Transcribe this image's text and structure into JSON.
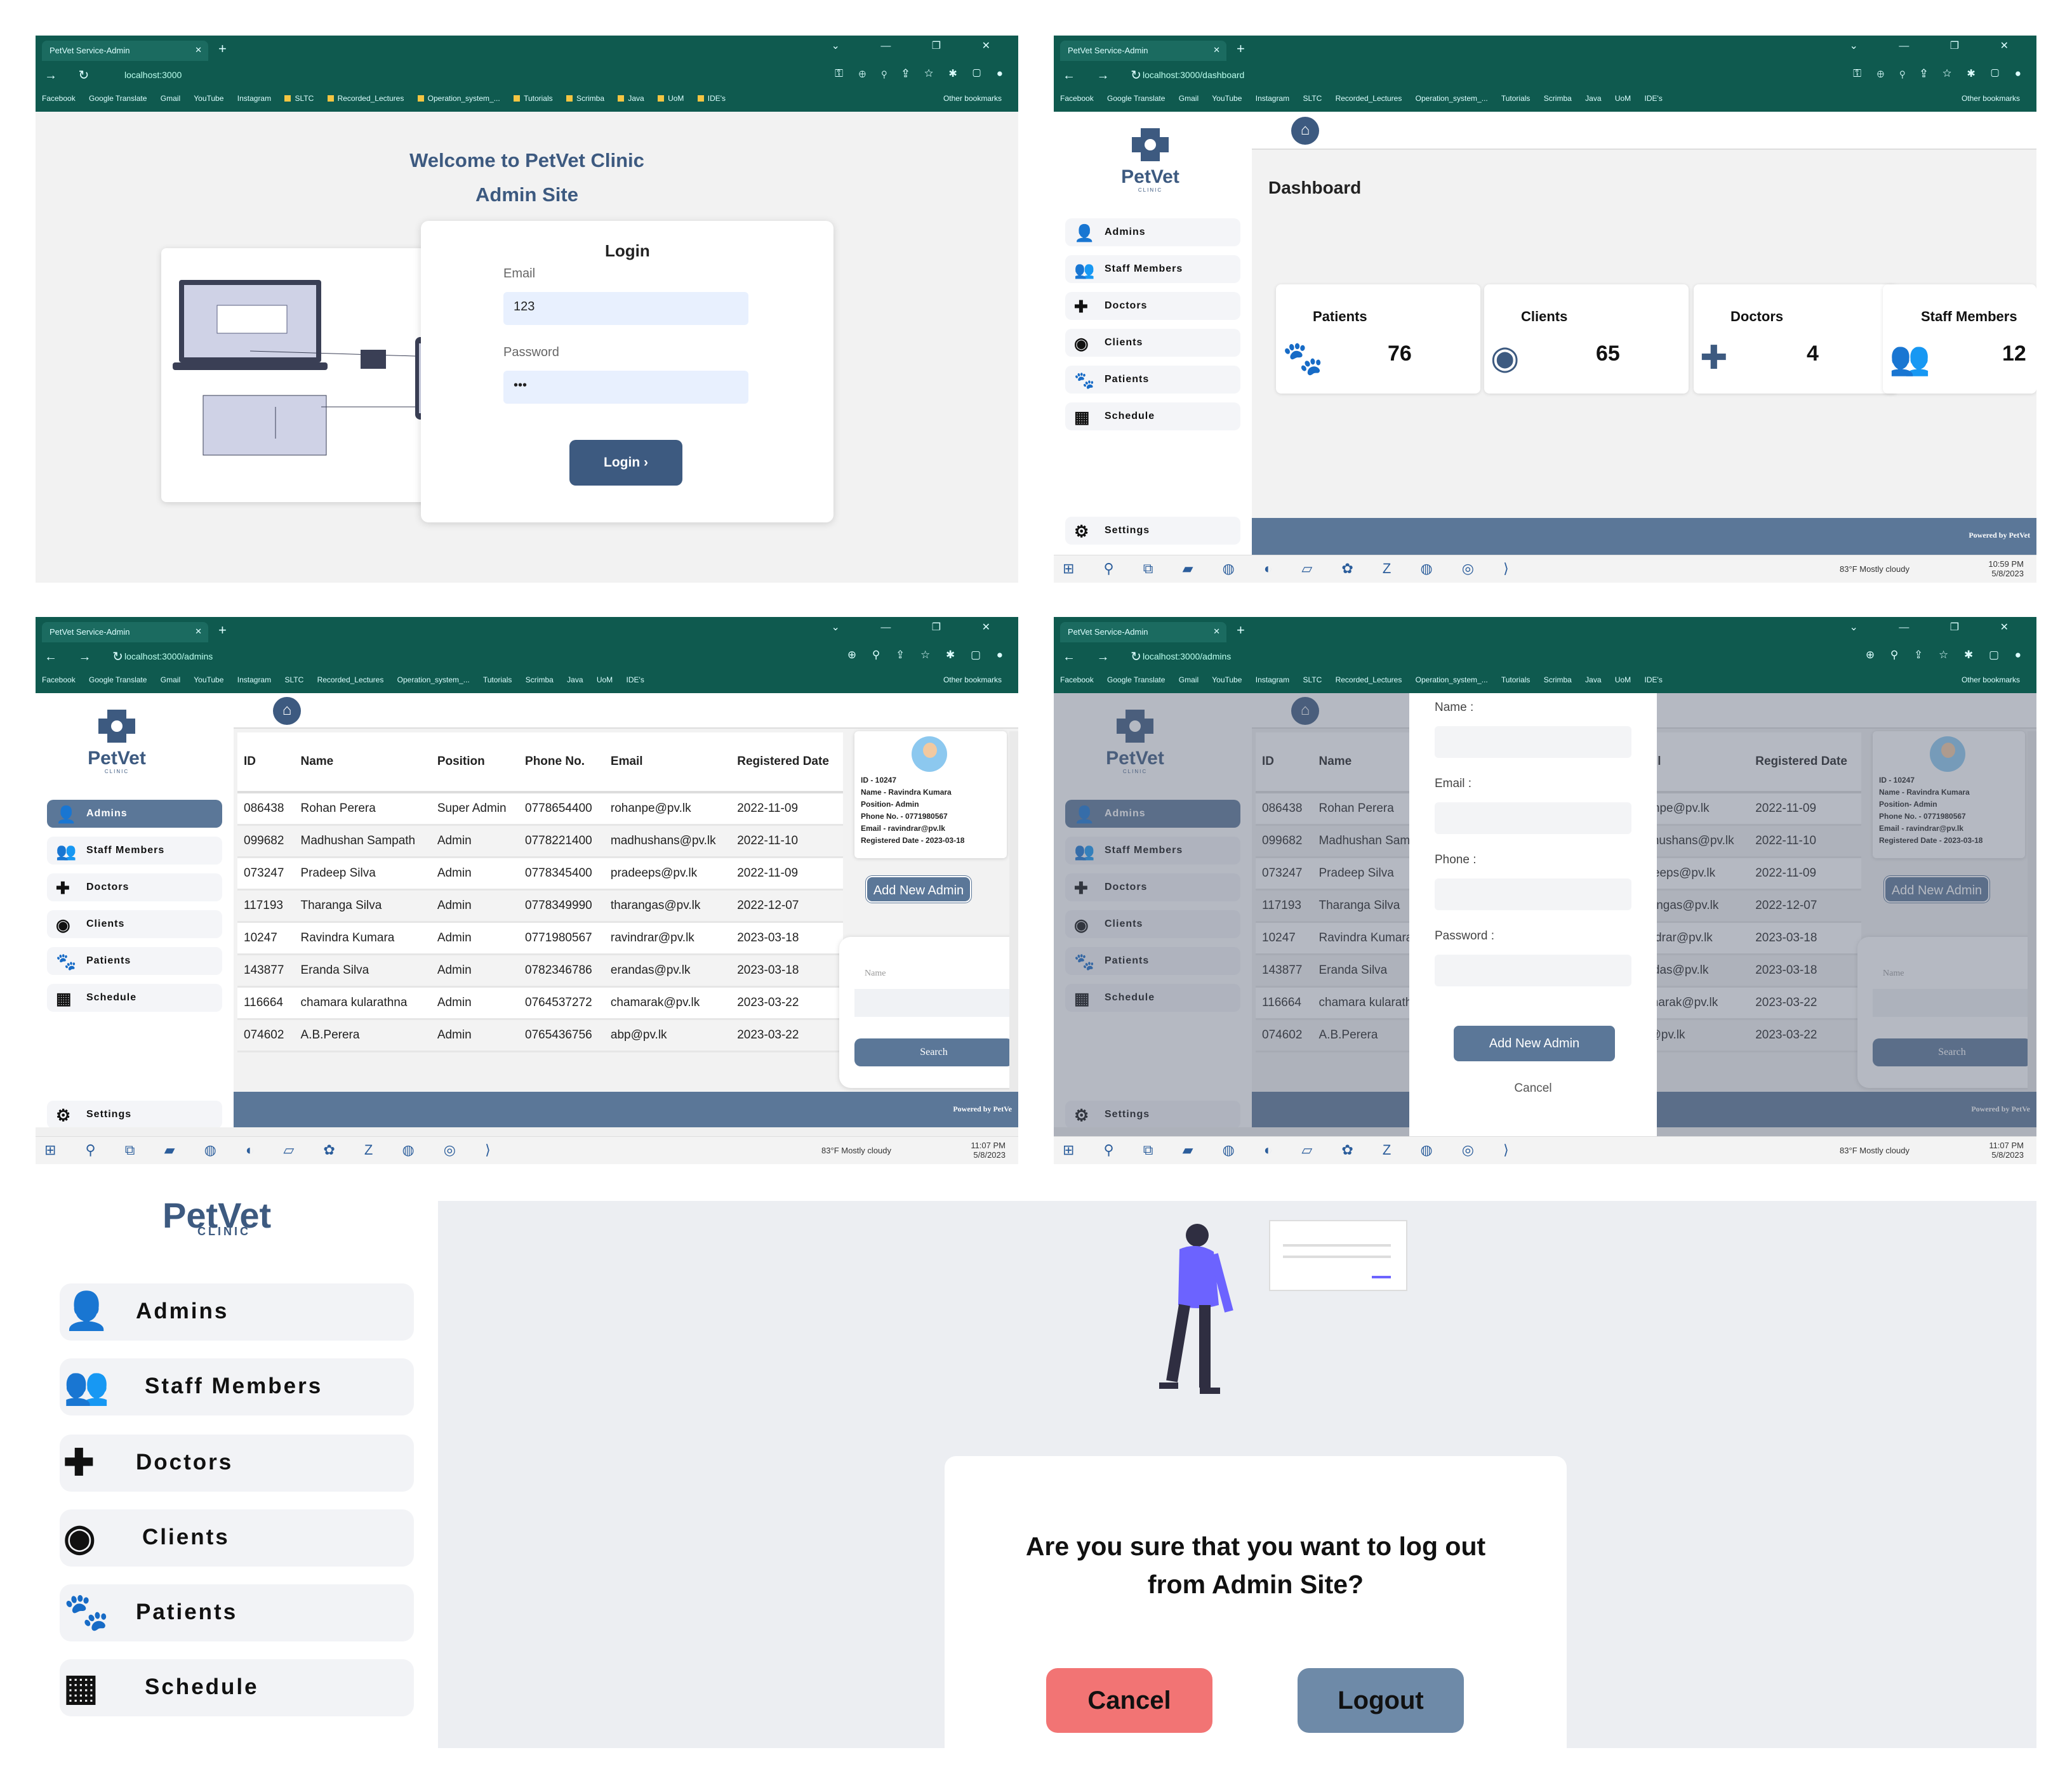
{
  "browser": {
    "tab_title": "PetVet Service-Admin",
    "new_tab": "+",
    "win_controls": "⌄ — ❐ ✕",
    "bookmarks": [
      "Facebook",
      "Google Translate",
      "Gmail",
      "YouTube",
      "Instagram",
      "SLTC",
      "Recorded_Lectures",
      "Operation_system_...",
      "Tutorials",
      "Scrimba",
      "Java",
      "UoM",
      "IDE's"
    ],
    "bookmarks_more": "»",
    "other_bookmarks": "Other bookmarks"
  },
  "taskbar": {
    "weather": "83°F  Mostly cloudy",
    "time_dashboard": "10:59 PM",
    "time_admins": "11:07 PM",
    "date": "5/8/2023"
  },
  "login_page": {
    "url": "localhost:3000",
    "welcome_line1": "Welcome to PetVet Clinic",
    "welcome_line2": "Admin Site",
    "heading": "Login",
    "email_label": "Email",
    "email_value": "123",
    "password_label": "Password",
    "password_value": "•••",
    "login_button": "Login ›"
  },
  "sidebar": {
    "logo_text": "PetVet",
    "logo_sub": "CLINIC",
    "items": [
      {
        "label": "Admins",
        "icon": "user-icon"
      },
      {
        "label": "Staff Members",
        "icon": "users-icon"
      },
      {
        "label": "Doctors",
        "icon": "medkit-icon"
      },
      {
        "label": "Clients",
        "icon": "user-circle-icon"
      },
      {
        "label": "Patients",
        "icon": "paw-icon"
      },
      {
        "label": "Schedule",
        "icon": "calendar-icon"
      }
    ],
    "settings": "Settings"
  },
  "dashboard": {
    "url": "localhost:3000/dashboard",
    "title": "Dashboard",
    "stats": [
      {
        "label": "Patients",
        "value": "76",
        "icon": "paw-icon"
      },
      {
        "label": "Clients",
        "value": "65",
        "icon": "user-circle-icon"
      },
      {
        "label": "Doctors",
        "value": "4",
        "icon": "medkit-icon"
      },
      {
        "label": "Staff Members",
        "value": "12",
        "icon": "users-icon"
      }
    ],
    "footer": "Powered by PetVet"
  },
  "admins_page": {
    "url": "localhost:3000/admins",
    "columns": [
      "ID",
      "Name",
      "Position",
      "Phone No.",
      "Email",
      "Registered Date"
    ],
    "rows": [
      [
        "086438",
        "Rohan Perera",
        "Super Admin",
        "0778654400",
        "rohanpe@pv.lk",
        "2022-11-09"
      ],
      [
        "099682",
        "Madhushan Sampath",
        "Admin",
        "0778221400",
        "madhushans@pv.lk",
        "2022-11-10"
      ],
      [
        "073247",
        "Pradeep Silva",
        "Admin",
        "0778345400",
        "pradeeps@pv.lk",
        "2022-11-09"
      ],
      [
        "117193",
        "Tharanga Silva",
        "Admin",
        "0778349990",
        "tharangas@pv.lk",
        "2022-12-07"
      ],
      [
        "10247",
        "Ravindra Kumara",
        "Admin",
        "0771980567",
        "ravindrar@pv.lk",
        "2023-03-18"
      ],
      [
        "143877",
        "Eranda Silva",
        "Admin",
        "0782346786",
        "erandas@pv.lk",
        "2023-03-18"
      ],
      [
        "116664",
        "chamara kularathna",
        "Admin",
        "0764537272",
        "chamarak@pv.lk",
        "2023-03-22"
      ],
      [
        "074602",
        "A.B.Perera",
        "Admin",
        "0765436756",
        "abp@pv.lk",
        "2023-03-22"
      ]
    ],
    "profile": {
      "id": "ID - 10247",
      "name": "Name - Ravindra Kumara",
      "position": "Position- Admin",
      "phone": "Phone No. - 0771980567",
      "email": "Email - ravindrar@pv.lk",
      "registered": "Registered Date - 2023-03-18"
    },
    "add_button": "Add New Admin",
    "search_label": "Name",
    "search_button": "Search",
    "footer": "Powered by PetVe"
  },
  "add_admin_modal": {
    "name_label": "Name :",
    "email_label": "Email :",
    "phone_label": "Phone :",
    "password_label": "Password :",
    "submit": "Add New Admin",
    "cancel": "Cancel"
  },
  "logout_page": {
    "logo_text": "PetVet",
    "logo_sub": "CLINIC",
    "question_line1": "Are you sure that you want to log out",
    "question_line2": "from Admin Site?",
    "cancel": "Cancel",
    "logout": "Logout",
    "colors": {
      "cancel": "#f27474",
      "logout": "#6e8aa8",
      "accent": "#3d5a80"
    }
  }
}
